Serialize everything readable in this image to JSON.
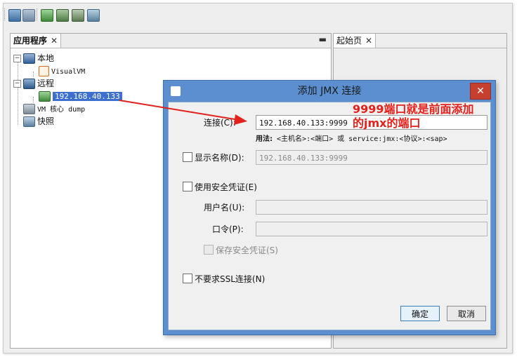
{
  "colors": {
    "accent": "#3d6fce",
    "dialog_frame": "#5b8fcf",
    "close_red": "#c6402f",
    "annotation_red": "#e5201a"
  },
  "toolbar": {
    "icons": [
      "open-icon",
      "save-icon",
      "add-host-icon",
      "add-jmx-icon",
      "add-core-dump-icon",
      "add-snapshot-icon"
    ]
  },
  "left_panel": {
    "tab_label": "应用程序",
    "tree": {
      "local": "本地",
      "visualvm": "VisualVM",
      "remote": "远程",
      "remote_host": "192.168.40.133",
      "core_dump": "VM 核心 dump",
      "snapshot": "快照"
    }
  },
  "right_panel": {
    "tab_label": "起始页"
  },
  "dialog": {
    "title": "添加 JMX 连接",
    "connection_label": "连接(C):",
    "connection_value": "192.168.40.133:9999",
    "usage_bold": "用法:",
    "usage_text": "<主机名>:<端口> 或 service:jmx:<协议>:<sap>",
    "display_name_label": "显示名称(D):",
    "display_name_value": "192.168.40.133:9999",
    "use_credentials_label": "使用安全凭证(E)",
    "username_label": "用户名(U):",
    "password_label": "口令(P):",
    "save_credentials_label": "保存安全凭证(S)",
    "no_ssl_label": "不要求SSL连接(N)",
    "ok_label": "确定",
    "cancel_label": "取消"
  },
  "annotation": {
    "line1": "9999端口就是前面添加",
    "line2": "的jmx的端口"
  }
}
